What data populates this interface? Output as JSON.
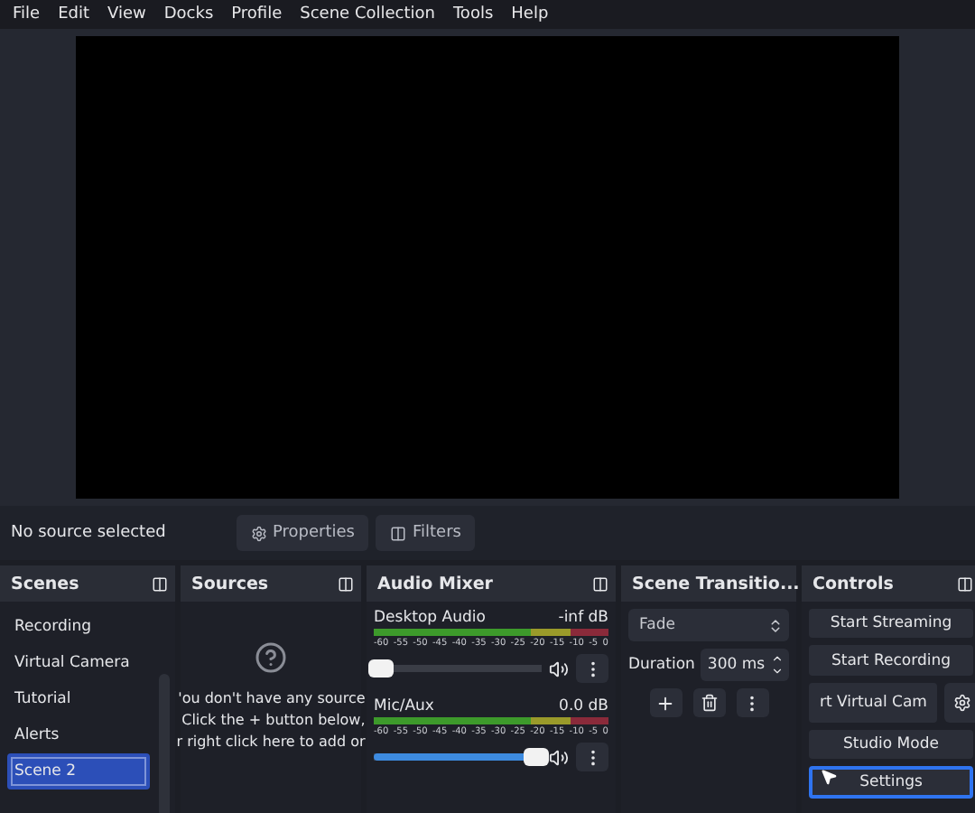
{
  "menu": [
    "File",
    "Edit",
    "View",
    "Docks",
    "Profile",
    "Scene Collection",
    "Tools",
    "Help"
  ],
  "source_bar": {
    "status": "No source selected",
    "buttons": [
      {
        "kind": "properties",
        "label": "Properties"
      },
      {
        "kind": "filters",
        "label": "Filters"
      }
    ]
  },
  "scenes": {
    "title": "Scenes",
    "items": [
      {
        "label": "Recording",
        "selected": false
      },
      {
        "label": "Virtual Camera",
        "selected": false
      },
      {
        "label": "Tutorial",
        "selected": false
      },
      {
        "label": "Alerts",
        "selected": false
      },
      {
        "label": "Scene 2",
        "selected": true
      }
    ]
  },
  "sources": {
    "title": "Sources",
    "empty_lines": [
      "'ou don't have any source",
      "Click the + button below,",
      "r right click here to add or"
    ]
  },
  "audio_mixer": {
    "title": "Audio Mixer",
    "channels": [
      {
        "name": "Desktop Audio",
        "reading": "-inf dB",
        "level": 0.04,
        "scale": [
          "-60",
          "-55",
          "-50",
          "-45",
          "-40",
          "-35",
          "-30",
          "-25",
          "-20",
          "-15",
          "-10",
          "-5",
          "0"
        ]
      },
      {
        "name": "Mic/Aux",
        "reading": "0.0 dB",
        "level": 0.97,
        "scale": [
          "-60",
          "-55",
          "-50",
          "-45",
          "-40",
          "-35",
          "-30",
          "-25",
          "-20",
          "-15",
          "-10",
          "-5",
          "0"
        ]
      }
    ]
  },
  "scene_transitions": {
    "title": "Scene Transitio...",
    "transition": "Fade",
    "duration_label": "Duration",
    "duration": "300 ms"
  },
  "controls": {
    "title": "Controls",
    "buttons": [
      {
        "label": "Start Streaming",
        "focused": false
      },
      {
        "label": "Start Recording",
        "focused": false
      },
      {
        "label": "rt Virtual Cam",
        "focused": false
      },
      {
        "label": "Studio Mode",
        "focused": false
      },
      {
        "label": "Settings",
        "focused": true
      }
    ]
  }
}
